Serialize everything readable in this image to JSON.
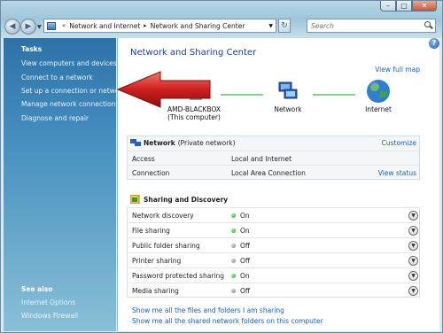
{
  "window": {
    "breadcrumb": [
      "Network and Internet",
      "Network and Sharing Center"
    ],
    "search_placeholder": "Search"
  },
  "sidebar": {
    "tasks_heading": "Tasks",
    "tasks": [
      "View computers and devices",
      "Connect to a network",
      "Set up a connection or network",
      "Manage network connections",
      "Diagnose and repair"
    ],
    "see_also_heading": "See also",
    "see_also": [
      "Internet Options",
      "Windows Firewall"
    ]
  },
  "main": {
    "title": "Network and Sharing Center",
    "view_full_map": "View full map",
    "map": {
      "computer_name": "AMD-BLACKBOX",
      "computer_sub": "(This computer)",
      "network_label": "Network",
      "internet_label": "Internet"
    },
    "network": {
      "name": "Network",
      "type": "(Private network)",
      "customize": "Customize",
      "rows": [
        {
          "label": "Access",
          "value": "Local and Internet",
          "action": ""
        },
        {
          "label": "Connection",
          "value": "Local Area Connection",
          "action": "View status"
        }
      ]
    },
    "sharing": {
      "heading": "Sharing and Discovery",
      "rows": [
        {
          "label": "Network discovery",
          "state": "On"
        },
        {
          "label": "File sharing",
          "state": "On"
        },
        {
          "label": "Public folder sharing",
          "state": "Off"
        },
        {
          "label": "Printer sharing",
          "state": "Off"
        },
        {
          "label": "Password protected sharing",
          "state": "On"
        },
        {
          "label": "Media sharing",
          "state": "Off"
        }
      ]
    },
    "links": [
      "Show me all the files and folders I am sharing",
      "Show me all the shared network folders on this computer"
    ]
  },
  "colors": {
    "on": "#17a317",
    "off": "#777777",
    "link": "#1a5fb0",
    "arrow": "#cc1f1f"
  }
}
